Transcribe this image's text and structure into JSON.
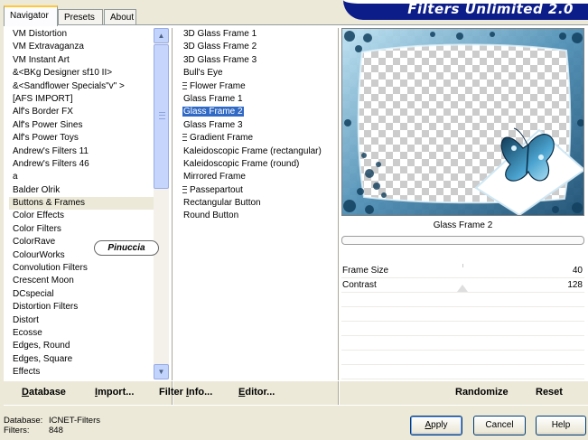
{
  "tabs": [
    {
      "label": "Navigator",
      "active": true
    },
    {
      "label": "Presets",
      "active": false
    },
    {
      "label": "About",
      "active": false
    }
  ],
  "banner": {
    "title": "Filters Unlimited 2.0"
  },
  "categories": [
    "VM Distortion",
    "VM Extravaganza",
    "VM Instant Art",
    "&<BKg Designer sf10 II>",
    "&<Sandflower Specials\"v\" >",
    "[AFS IMPORT]",
    "Alf's Border FX",
    "Alf's Power Sines",
    "Alf's Power Toys",
    "Andrew's Filters 11",
    "Andrew's Filters 46",
    "a",
    "Balder Olrik",
    "Buttons & Frames",
    "Color Effects",
    "Color Filters",
    "ColorRave",
    "ColourWorks",
    "Convolution Filters",
    "Crescent Moon",
    "DCspecial",
    "Distortion Filters",
    "Distort",
    "Ecosse",
    "Edges, Round",
    "Edges, Square",
    "Effects"
  ],
  "selected_category": "Buttons & Frames",
  "filters": [
    {
      "label": "3D Glass Frame 1",
      "group": false
    },
    {
      "label": "3D Glass Frame 2",
      "group": false
    },
    {
      "label": "3D Glass Frame 3",
      "group": false
    },
    {
      "label": "Bull's Eye",
      "group": false
    },
    {
      "label": "Flower Frame",
      "group": true
    },
    {
      "label": "Glass Frame 1",
      "group": false
    },
    {
      "label": "Glass Frame 2",
      "group": false
    },
    {
      "label": "Glass Frame 3",
      "group": false
    },
    {
      "label": "Gradient Frame",
      "group": true
    },
    {
      "label": "Kaleidoscopic Frame (rectangular)",
      "group": false
    },
    {
      "label": "Kaleidoscopic Frame (round)",
      "group": false
    },
    {
      "label": "Mirrored Frame",
      "group": false
    },
    {
      "label": "Passepartout",
      "group": true
    },
    {
      "label": "Rectangular Button",
      "group": false
    },
    {
      "label": "Round Button",
      "group": false
    }
  ],
  "selected_filter": "Glass Frame 2",
  "preview": {
    "filter_name": "Glass Frame 2"
  },
  "params": [
    {
      "name": "Frame Size",
      "value": "40",
      "slider": 0.16
    },
    {
      "name": "Contrast",
      "value": "128",
      "slider": 0.5
    }
  ],
  "toolbar": {
    "database": {
      "pre": "",
      "key": "D",
      "post": "atabase"
    },
    "import": {
      "pre": "",
      "key": "I",
      "post": "mport..."
    },
    "filter_info": {
      "pre": "Filter ",
      "key": "I",
      "post": "nfo..."
    },
    "editor": {
      "pre": "",
      "key": "E",
      "post": "ditor..."
    },
    "randomize": "Randomize",
    "reset": "Reset"
  },
  "status": {
    "database_label": "Database:",
    "database_value": "ICNET-Filters",
    "filters_label": "Filters:",
    "filters_value": "848"
  },
  "buttons": {
    "apply": {
      "key": "A",
      "post": "pply"
    },
    "cancel": "Cancel",
    "help": "Help"
  },
  "watermark": "Pinuccia",
  "colors": {
    "banner": "#0c1d8a",
    "selection": "#316ac5",
    "tab_highlight": "#ffc83c",
    "dialog_bg": "#ece9d8",
    "frame_art": "#4f8fb5"
  },
  "icons": {
    "scroll_up": "▲",
    "scroll_down": "▼"
  }
}
